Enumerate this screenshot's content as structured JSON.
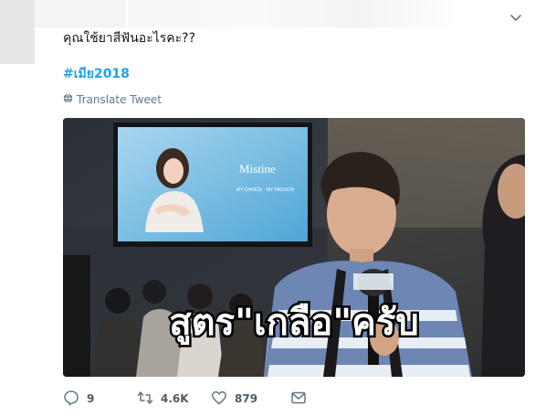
{
  "tweet": {
    "text": "คุณใช้ยาสีฟันอะไรคะ??",
    "hashtag": "#เมีย2018",
    "translate_label": "Translate Tweet"
  },
  "media": {
    "billboard_brand": "Mistine",
    "billboard_tagline": "MY CHOICE · MY PASSION",
    "caption": "สูตร\"เกลือ\"ครับ"
  },
  "actions": {
    "reply_count": "9",
    "retweet_count": "4.6K",
    "like_count": "879"
  },
  "colors": {
    "link": "#1da1f2",
    "muted": "#657786",
    "text": "#14171a"
  },
  "icons": {
    "caret": "chevron-down-icon",
    "translate": "globe-icon",
    "reply": "reply-icon",
    "retweet": "retweet-icon",
    "like": "heart-icon",
    "dm": "envelope-icon"
  }
}
